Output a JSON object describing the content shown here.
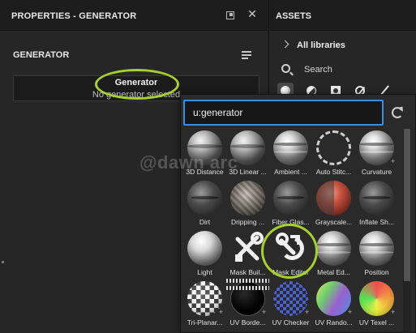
{
  "properties_panel": {
    "title": "PROPERTIES - GENERATOR",
    "section_title": "GENERATOR",
    "generator_name": "Generator",
    "generator_status": "No generator selected"
  },
  "assets_panel": {
    "title": "ASSETS",
    "libraries_label": "All libraries",
    "search_label": "Search",
    "filter_icons": [
      "sphere-filter-icon",
      "half-sphere-filter-icon",
      "square-filter-icon",
      "slash-circle-filter-icon",
      "brush-filter-icon"
    ]
  },
  "popup": {
    "search_value": "u:generator",
    "items": [
      {
        "label": "3D Distance",
        "style": "s-metal"
      },
      {
        "label": "3D Linear ...",
        "style": "s-metal"
      },
      {
        "label": "Ambient ...",
        "style": "s-chrome"
      },
      {
        "label": "Auto Stitc...",
        "style": "s-dots"
      },
      {
        "label": "Curvature",
        "style": "s-chrome"
      },
      {
        "label": "Dirt",
        "style": "s-dark"
      },
      {
        "label": "Dripping ...",
        "style": "s-rock"
      },
      {
        "label": "Fiber Glas...",
        "style": "s-dark"
      },
      {
        "label": "Grayscale...",
        "style": "s-red"
      },
      {
        "label": "Inflate Sh...",
        "style": "s-dark"
      },
      {
        "label": "Light",
        "style": "s-light"
      },
      {
        "label": "Mask Buil...",
        "style": "tool-builder"
      },
      {
        "label": "Mask Editor",
        "style": "tool-editor"
      },
      {
        "label": "Metal Ed...",
        "style": "s-chrome"
      },
      {
        "label": "Position",
        "style": "s-chrome"
      },
      {
        "label": "Tri-Planar...",
        "style": "s-checker"
      },
      {
        "label": "UV Borde...",
        "style": "s-black"
      },
      {
        "label": "UV Checker",
        "style": "s-uvchecker"
      },
      {
        "label": "UV Rando...",
        "style": "s-uvrandom"
      },
      {
        "label": "UV Texel ...",
        "style": "s-uvtexel"
      }
    ]
  },
  "watermark": "@dawn arc",
  "colors": {
    "highlight": "#a6d12a",
    "focus_border": "#3d8ee0",
    "panel_bg": "#262626",
    "header_bg": "#1d1d1d"
  }
}
